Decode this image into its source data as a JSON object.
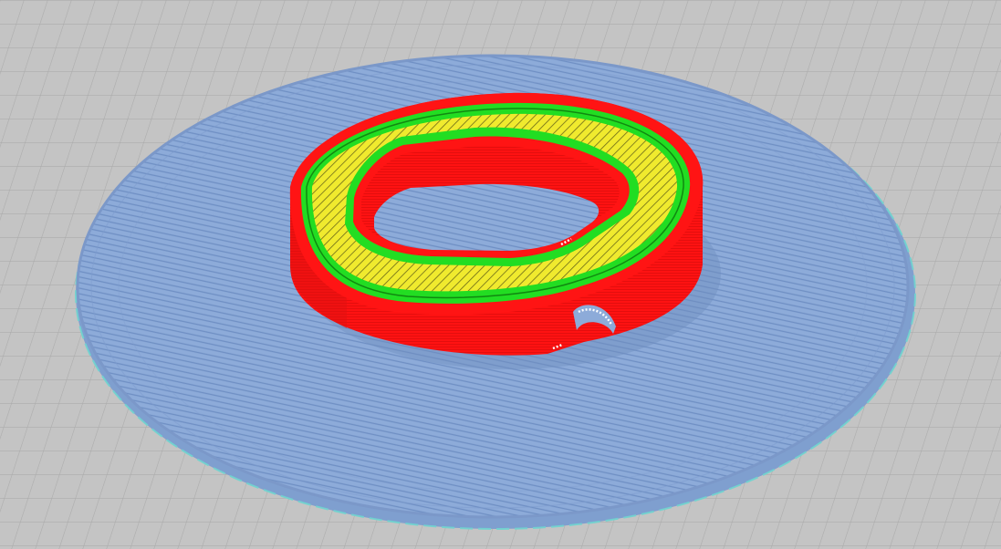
{
  "viewport": {
    "view": "layer-preview",
    "background_color": "#c4c4c4",
    "grid_line_color": "#a8a8a8"
  },
  "build_plate": {
    "grid": true
  },
  "model": {
    "brim_color": "#8aa8d8",
    "brim_edge_color": "#6fd4cf",
    "outer_wall_color": "#ff1414",
    "inner_wall_color": "#22dd22",
    "infill_color": "#f0ea2e",
    "seam_markers_color": "#ffffff"
  }
}
